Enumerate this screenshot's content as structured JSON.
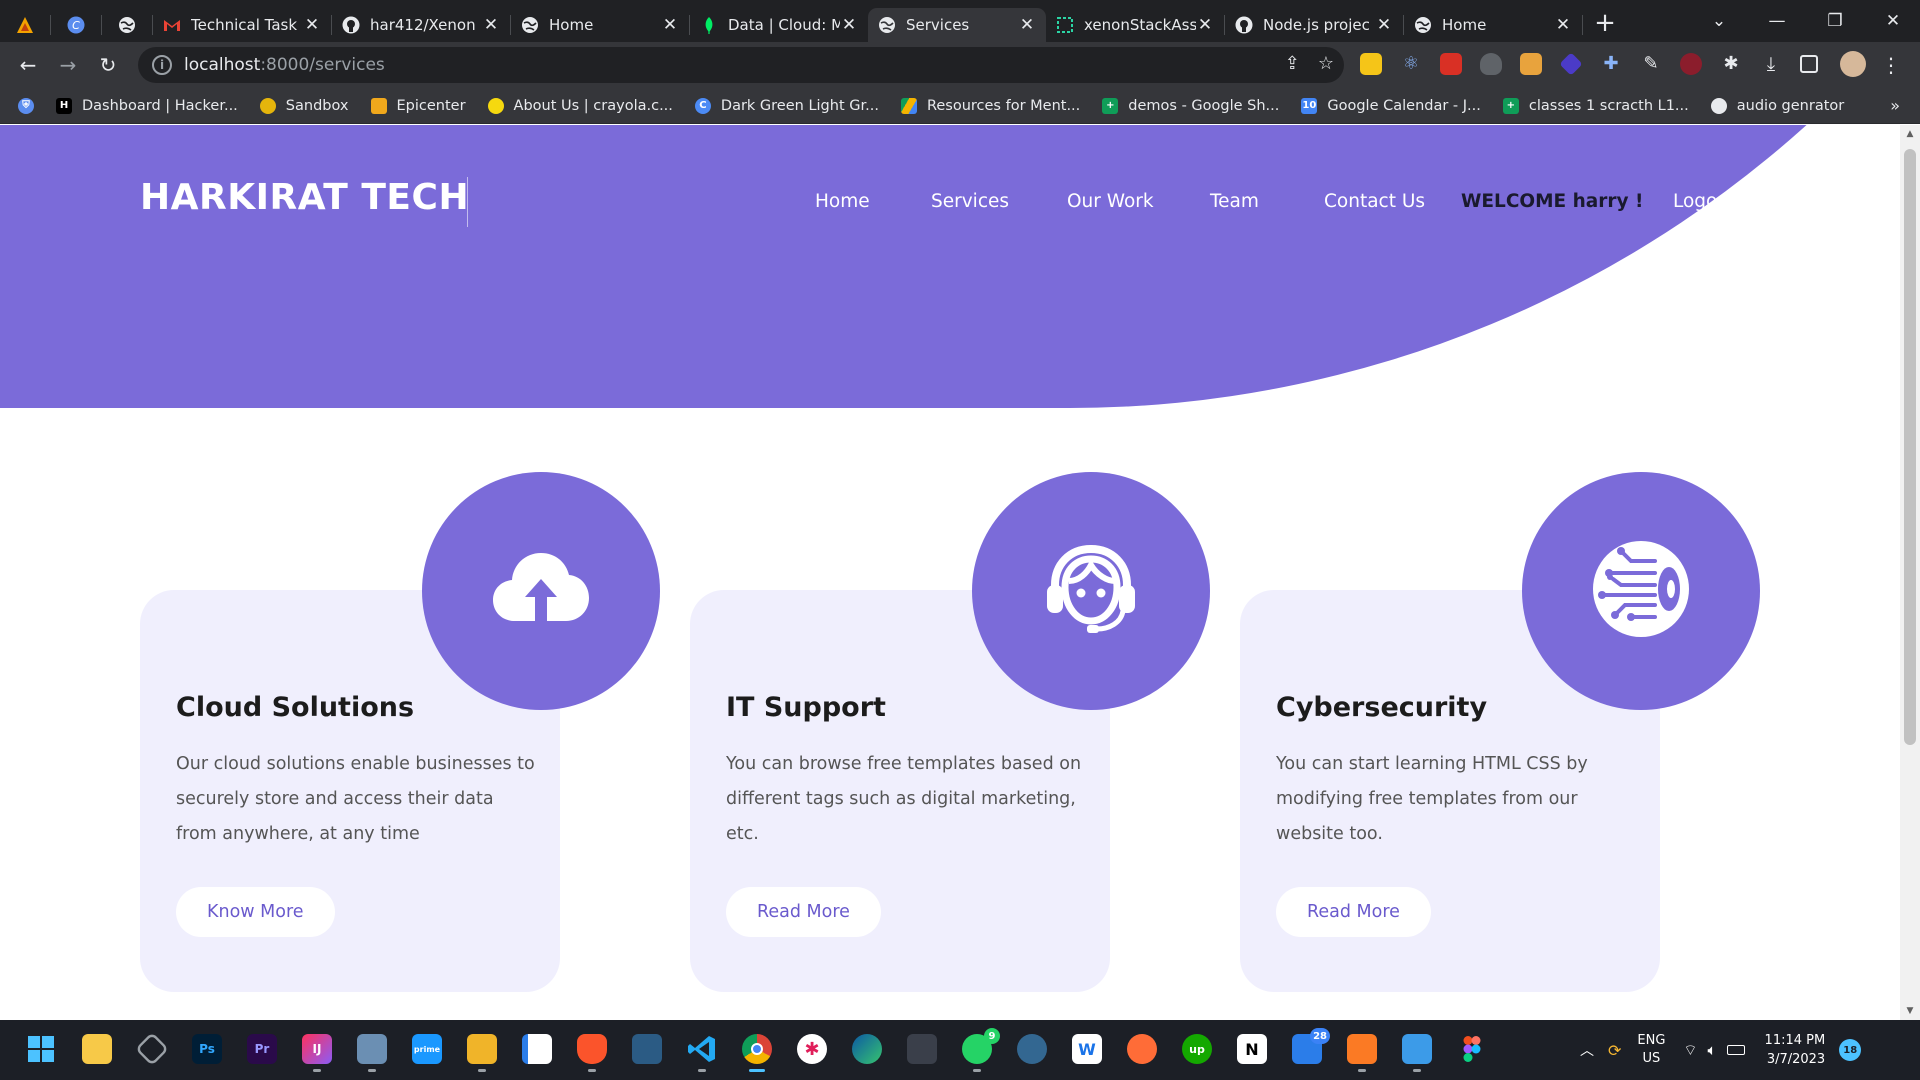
{
  "browser": {
    "tabs": [
      {
        "title": "",
        "icon": "triangle-app-icon"
      },
      {
        "title": "",
        "icon": "canva-icon"
      },
      {
        "title": "",
        "icon": "globe-icon"
      },
      {
        "title": "Technical Task",
        "icon": "gmail-icon"
      },
      {
        "title": "har412/Xenon",
        "icon": "github-icon"
      },
      {
        "title": "Home",
        "icon": "globe-icon"
      },
      {
        "title": "Data | Cloud: M",
        "icon": "mongodb-icon"
      },
      {
        "title": "Services",
        "icon": "globe-icon",
        "active": true
      },
      {
        "title": "xenonStackAss",
        "icon": "replit-icon"
      },
      {
        "title": "Node.js projec",
        "icon": "github-icon"
      },
      {
        "title": "Home",
        "icon": "globe-icon"
      }
    ],
    "url_host": "localhost",
    "url_path": ":8000/services",
    "bookmarks": [
      {
        "label": "",
        "icon": "shield-ext-icon"
      },
      {
        "label": "Dashboard | Hacker...",
        "icon": "hackerrank-icon"
      },
      {
        "label": "Sandbox",
        "icon": "sandbox-icon"
      },
      {
        "label": "Epicenter",
        "icon": "epicenter-icon"
      },
      {
        "label": "About Us | crayola.c...",
        "icon": "crayola-icon"
      },
      {
        "label": "Dark Green Light Gr...",
        "icon": "canva-icon"
      },
      {
        "label": "Resources for Ment...",
        "icon": "drive-icon"
      },
      {
        "label": "demos - Google Sh...",
        "icon": "sheets-icon"
      },
      {
        "label": "Google Calendar - J...",
        "icon": "calendar-icon"
      },
      {
        "label": "classes 1 scracth L1...",
        "icon": "sheets-icon"
      },
      {
        "label": "audio genrator",
        "icon": "globe-icon"
      }
    ],
    "more_bookmarks": "»"
  },
  "site": {
    "logo": "HARKIRAT TECH",
    "nav": {
      "home": "Home",
      "services": "Services",
      "our_work": "Our Work",
      "team": "Team",
      "contact": "Contact Us",
      "welcome": "WELCOME harry !",
      "logout": "Logout"
    },
    "cards": [
      {
        "title": "Cloud Solutions",
        "text": "Our cloud solutions enable businesses to securely store and access their data from anywhere, at any time",
        "button": "Know More",
        "icon": "cloud-upload-icon"
      },
      {
        "title": "IT Support",
        "text": "You can browse free templates based on different tags such as digital marketing, etc.",
        "button": "Read More",
        "icon": "headset-support-icon"
      },
      {
        "title": "Cybersecurity",
        "text": "You can start learning HTML CSS by modifying free templates from our website too.",
        "button": "Read More",
        "icon": "cyber-circuit-icon"
      }
    ],
    "colors": {
      "primary": "#7b6bd9",
      "card_bg": "#f0effd",
      "button_text": "#6a5acd"
    }
  },
  "taskbar": {
    "badges": {
      "whatsapp": "9",
      "mail": "28"
    },
    "language": "ENG",
    "region": "US",
    "time": "11:14 PM",
    "date": "3/7/2023",
    "notifications": "18"
  }
}
